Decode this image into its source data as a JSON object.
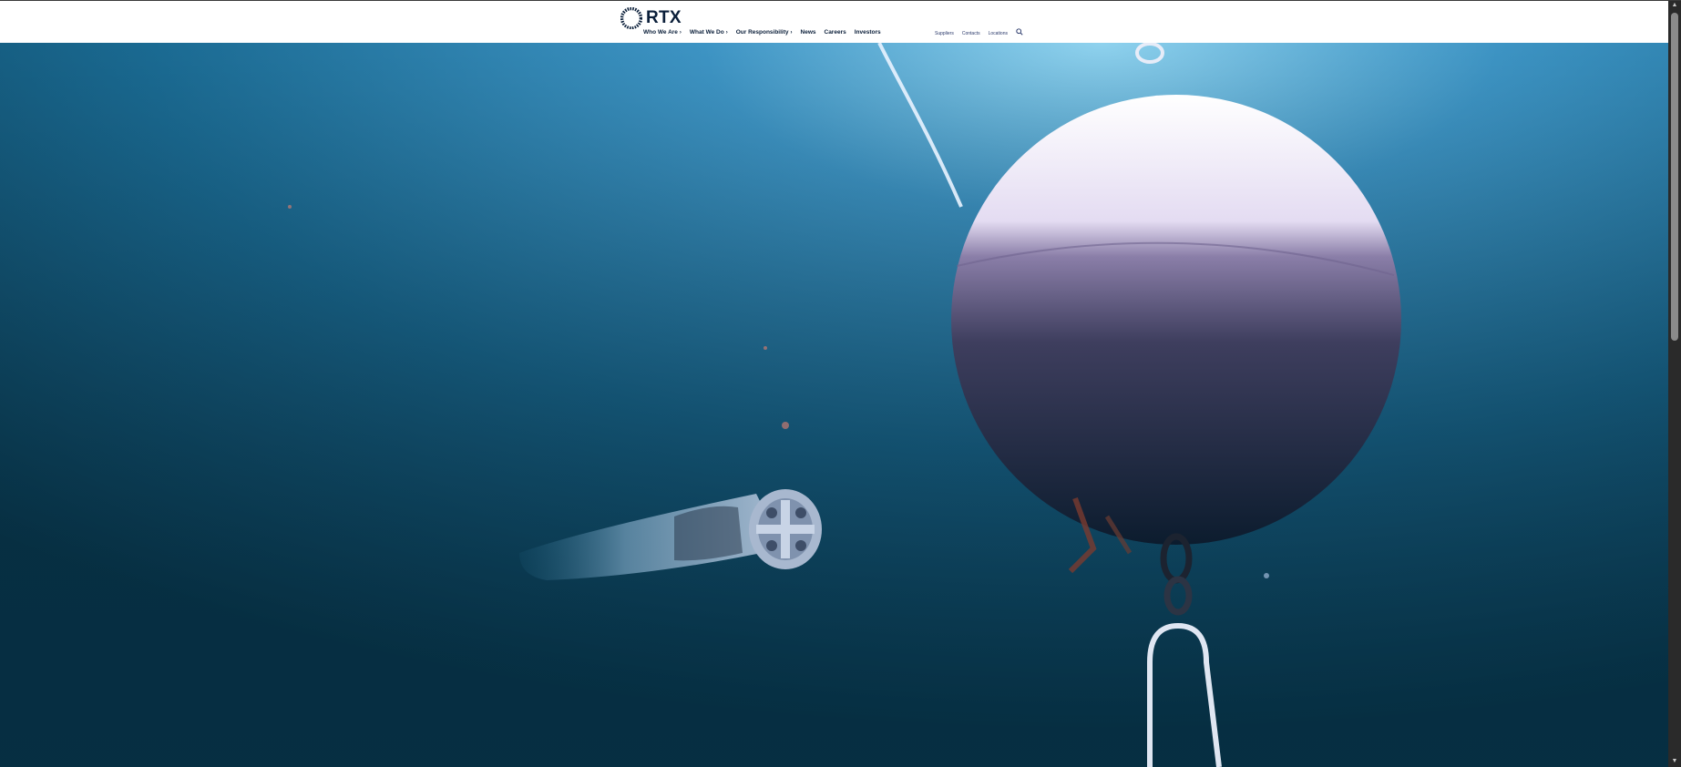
{
  "brand": {
    "name": "RTX"
  },
  "nav": {
    "main": [
      {
        "label": "Who We Are",
        "has_dropdown": true
      },
      {
        "label": "What We Do",
        "has_dropdown": true
      },
      {
        "label": "Our Responsibility",
        "has_dropdown": true
      },
      {
        "label": "News",
        "has_dropdown": false
      },
      {
        "label": "Careers",
        "has_dropdown": false
      },
      {
        "label": "Investors",
        "has_dropdown": false
      }
    ],
    "utility": [
      {
        "label": "Suppliers"
      },
      {
        "label": "Contacts"
      },
      {
        "label": "Locations"
      }
    ],
    "search_icon": "search-icon"
  },
  "hero": {
    "icons": [
      "underwater-vehicle",
      "buoy"
    ]
  },
  "colors": {
    "brand_navy": "#0b1f3a",
    "water_light": "#3f8fc0",
    "water_dark": "#0a3a4e"
  }
}
